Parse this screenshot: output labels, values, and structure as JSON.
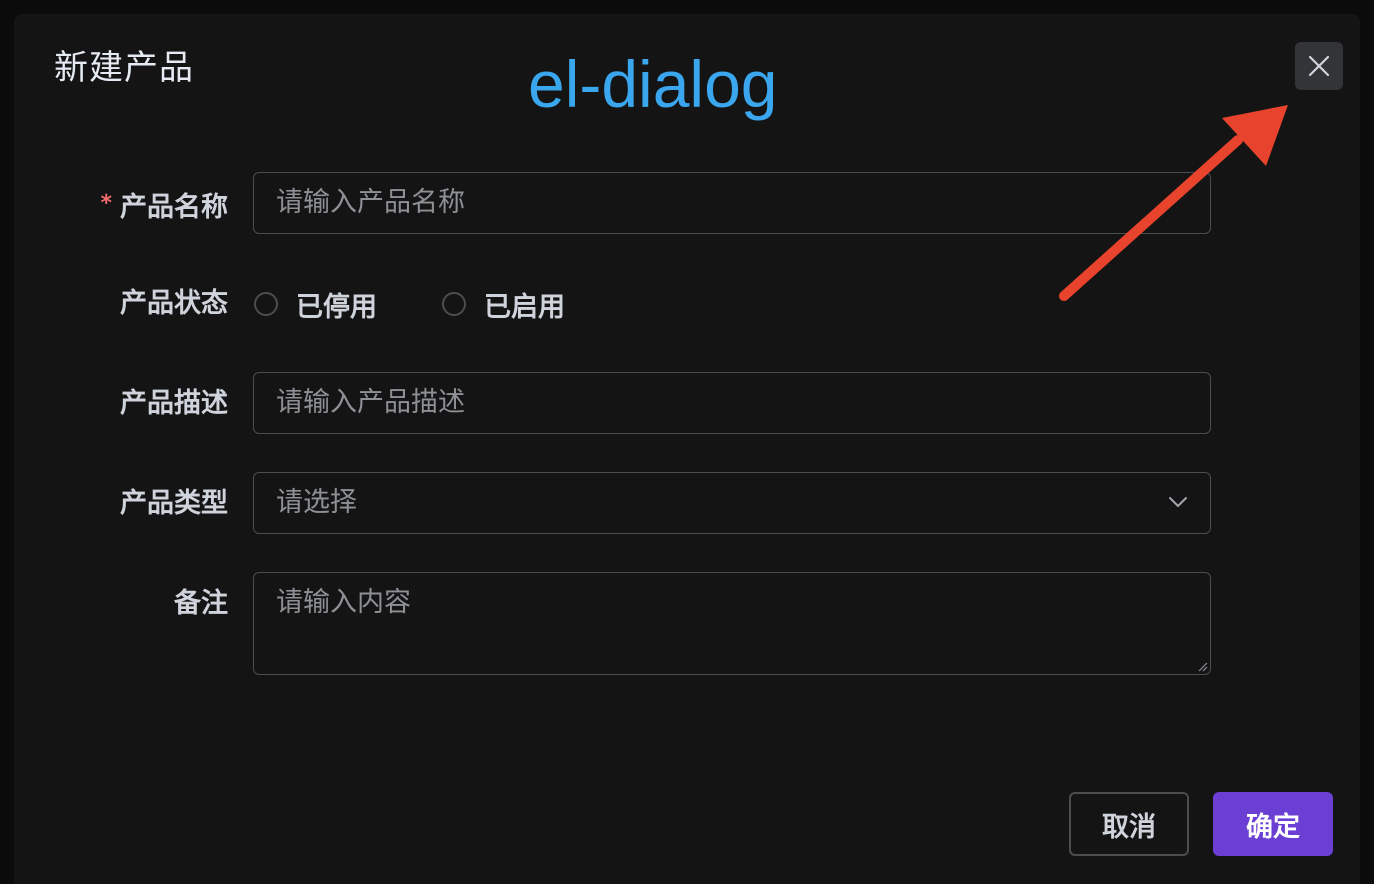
{
  "dialog": {
    "title": "新建产品",
    "overlay_label": "el-dialog",
    "close_icon": "close-icon"
  },
  "form": {
    "name": {
      "required": "*",
      "label": "产品名称",
      "placeholder": "请输入产品名称"
    },
    "status": {
      "label": "产品状态",
      "options": [
        {
          "label": "已停用",
          "selected": false
        },
        {
          "label": "已启用",
          "selected": false
        }
      ]
    },
    "description": {
      "label": "产品描述",
      "placeholder": "请输入产品描述"
    },
    "type": {
      "label": "产品类型",
      "placeholder": "请选择",
      "icon": "chevron-down-icon"
    },
    "remark": {
      "label": "备注",
      "placeholder": "请输入内容"
    }
  },
  "footer": {
    "cancel_label": "取消",
    "confirm_label": "确定"
  },
  "colors": {
    "accent": "#6b3fd4",
    "annotation_label": "#3aa6ee",
    "annotation_arrow": "#e8432d",
    "required": "#f56c6c"
  }
}
